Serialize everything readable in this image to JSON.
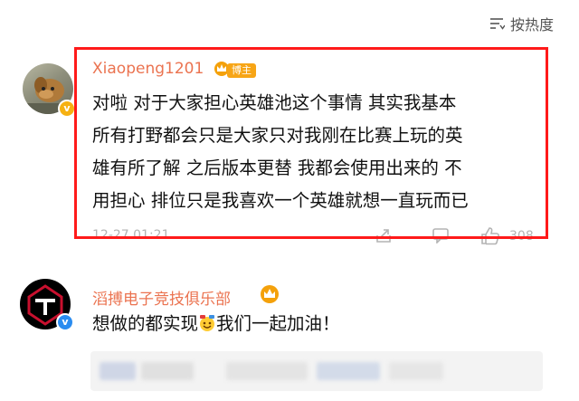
{
  "sort": {
    "label": "按热度",
    "icon": "sort-icon"
  },
  "comment1": {
    "username": "Xiaopeng1201",
    "badge": "博主",
    "lines": [
      "对啦 对于大家担心英雄池这个事情 其实我基本",
      "所有打野都会只是大家只对我刚在比赛上玩的英",
      "雄有所了解 之后版本更替 我都会使用出来的 不",
      "用担心 排位只是我喜欢一个英雄就想一直玩而已"
    ],
    "timestamp": "12-27 01:21",
    "likes": "308",
    "icons": [
      "share-icon",
      "reply-icon",
      "like-icon"
    ]
  },
  "comment2": {
    "username": "滔搏电子竞技俱乐部",
    "text_before": "想做的都实现",
    "text_after": "我们一起加油！"
  },
  "colors": {
    "accent": "#eb7350",
    "highlight": "#ff1a1a",
    "badge": "#f7a516",
    "verify_blue": "#2a8cf0",
    "verify_gold": "#f6b112"
  }
}
